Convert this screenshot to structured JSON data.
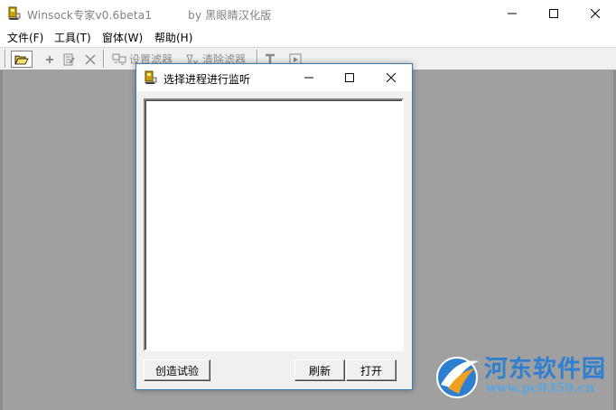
{
  "app": {
    "title": "Winsock专家v0.6beta1",
    "credit": "by 黑眼睛汉化版"
  },
  "menu": [
    "文件(F)",
    "工具(T)",
    "窗体(W)",
    "帮助(H)"
  ],
  "toolbar": {
    "set_filter": "设置滤器",
    "clear_filter": "清除滤器"
  },
  "dialog": {
    "title": "选择进程进行监听",
    "create_test": "创造试验",
    "refresh": "刷新",
    "open": "打开"
  },
  "watermark": {
    "name": "河东软件园",
    "url": "www.pc0359.cn"
  },
  "colors": {
    "workspace": "#a0a0a0",
    "dialog_border": "#3c7fb1",
    "watermark_blue": "#2f7fd0"
  }
}
